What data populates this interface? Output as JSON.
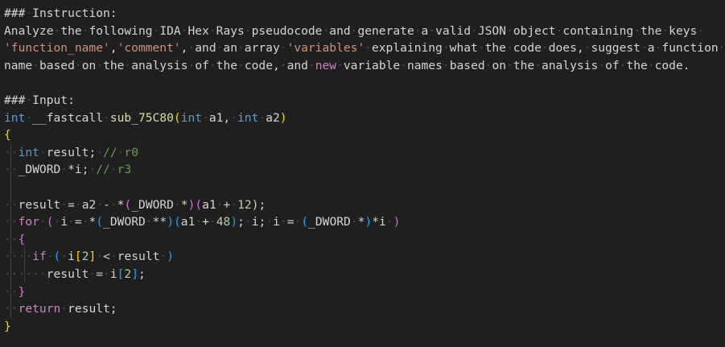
{
  "lines": [
    [
      {
        "t": "###",
        "c": "txt"
      },
      {
        "t": "·",
        "c": "ws"
      },
      {
        "t": "Instruction:",
        "c": "txt"
      }
    ],
    [
      {
        "t": "Analyze",
        "c": "txt"
      },
      {
        "t": "·",
        "c": "ws"
      },
      {
        "t": "the",
        "c": "txt"
      },
      {
        "t": "·",
        "c": "ws"
      },
      {
        "t": "following",
        "c": "txt"
      },
      {
        "t": "·",
        "c": "ws"
      },
      {
        "t": "IDA",
        "c": "txt"
      },
      {
        "t": "·",
        "c": "ws"
      },
      {
        "t": "Hex",
        "c": "txt"
      },
      {
        "t": "·",
        "c": "ws"
      },
      {
        "t": "Rays",
        "c": "txt"
      },
      {
        "t": "·",
        "c": "ws"
      },
      {
        "t": "pseudocode",
        "c": "txt"
      },
      {
        "t": "·",
        "c": "ws"
      },
      {
        "t": "and",
        "c": "txt"
      },
      {
        "t": "·",
        "c": "ws"
      },
      {
        "t": "generate",
        "c": "txt"
      },
      {
        "t": "·",
        "c": "ws"
      },
      {
        "t": "a",
        "c": "txt"
      },
      {
        "t": "·",
        "c": "ws"
      },
      {
        "t": "valid",
        "c": "txt"
      },
      {
        "t": "·",
        "c": "ws"
      },
      {
        "t": "JSON",
        "c": "txt"
      },
      {
        "t": "·",
        "c": "ws"
      },
      {
        "t": "object",
        "c": "txt"
      },
      {
        "t": "·",
        "c": "ws"
      },
      {
        "t": "containing",
        "c": "txt"
      },
      {
        "t": "·",
        "c": "ws"
      },
      {
        "t": "the",
        "c": "txt"
      },
      {
        "t": "·",
        "c": "ws"
      },
      {
        "t": "keys",
        "c": "txt"
      },
      {
        "t": "·",
        "c": "ws"
      }
    ],
    [
      {
        "t": "'function_name'",
        "c": "str"
      },
      {
        "t": ",",
        "c": "txt"
      },
      {
        "t": "'comment'",
        "c": "str"
      },
      {
        "t": ",",
        "c": "txt"
      },
      {
        "t": "·",
        "c": "ws"
      },
      {
        "t": "and",
        "c": "txt"
      },
      {
        "t": "·",
        "c": "ws"
      },
      {
        "t": "an",
        "c": "txt"
      },
      {
        "t": "·",
        "c": "ws"
      },
      {
        "t": "array",
        "c": "txt"
      },
      {
        "t": "·",
        "c": "ws"
      },
      {
        "t": "'variables'",
        "c": "str"
      },
      {
        "t": "·",
        "c": "ws"
      },
      {
        "t": "explaining",
        "c": "txt"
      },
      {
        "t": "·",
        "c": "ws"
      },
      {
        "t": "what",
        "c": "txt"
      },
      {
        "t": "·",
        "c": "ws"
      },
      {
        "t": "the",
        "c": "txt"
      },
      {
        "t": "·",
        "c": "ws"
      },
      {
        "t": "code",
        "c": "txt"
      },
      {
        "t": "·",
        "c": "ws"
      },
      {
        "t": "does,",
        "c": "txt"
      },
      {
        "t": "·",
        "c": "ws"
      },
      {
        "t": "suggest",
        "c": "txt"
      },
      {
        "t": "·",
        "c": "ws"
      },
      {
        "t": "a",
        "c": "txt"
      },
      {
        "t": "·",
        "c": "ws"
      },
      {
        "t": "function",
        "c": "txt"
      },
      {
        "t": "·",
        "c": "ws"
      }
    ],
    [
      {
        "t": "name",
        "c": "txt"
      },
      {
        "t": "·",
        "c": "ws"
      },
      {
        "t": "based",
        "c": "txt"
      },
      {
        "t": "·",
        "c": "ws"
      },
      {
        "t": "on",
        "c": "txt"
      },
      {
        "t": "·",
        "c": "ws"
      },
      {
        "t": "the",
        "c": "txt"
      },
      {
        "t": "·",
        "c": "ws"
      },
      {
        "t": "analysis",
        "c": "txt"
      },
      {
        "t": "·",
        "c": "ws"
      },
      {
        "t": "of",
        "c": "txt"
      },
      {
        "t": "·",
        "c": "ws"
      },
      {
        "t": "the",
        "c": "txt"
      },
      {
        "t": "·",
        "c": "ws"
      },
      {
        "t": "code,",
        "c": "txt"
      },
      {
        "t": "·",
        "c": "ws"
      },
      {
        "t": "and",
        "c": "txt"
      },
      {
        "t": "·",
        "c": "ws"
      },
      {
        "t": "new",
        "c": "ctl"
      },
      {
        "t": "·",
        "c": "ws"
      },
      {
        "t": "variable",
        "c": "txt"
      },
      {
        "t": "·",
        "c": "ws"
      },
      {
        "t": "names",
        "c": "txt"
      },
      {
        "t": "·",
        "c": "ws"
      },
      {
        "t": "based",
        "c": "txt"
      },
      {
        "t": "·",
        "c": "ws"
      },
      {
        "t": "on",
        "c": "txt"
      },
      {
        "t": "·",
        "c": "ws"
      },
      {
        "t": "the",
        "c": "txt"
      },
      {
        "t": "·",
        "c": "ws"
      },
      {
        "t": "analysis",
        "c": "txt"
      },
      {
        "t": "·",
        "c": "ws"
      },
      {
        "t": "of",
        "c": "txt"
      },
      {
        "t": "·",
        "c": "ws"
      },
      {
        "t": "the",
        "c": "txt"
      },
      {
        "t": "·",
        "c": "ws"
      },
      {
        "t": "code.",
        "c": "txt"
      }
    ],
    [],
    [
      {
        "t": "###",
        "c": "txt"
      },
      {
        "t": "·",
        "c": "ws"
      },
      {
        "t": "Input:",
        "c": "txt"
      }
    ],
    [
      {
        "t": "int",
        "c": "kw"
      },
      {
        "t": "·",
        "c": "ws"
      },
      {
        "t": "__fastcall",
        "c": "txt"
      },
      {
        "t": "·",
        "c": "ws"
      },
      {
        "t": "sub_75C80",
        "c": "fn"
      },
      {
        "t": "(",
        "c": "br1"
      },
      {
        "t": "int",
        "c": "kw"
      },
      {
        "t": "·",
        "c": "ws"
      },
      {
        "t": "a1,",
        "c": "txt"
      },
      {
        "t": "·",
        "c": "ws"
      },
      {
        "t": "int",
        "c": "kw"
      },
      {
        "t": "·",
        "c": "ws"
      },
      {
        "t": "a2",
        "c": "txt"
      },
      {
        "t": ")",
        "c": "br1"
      }
    ],
    [
      {
        "t": "{",
        "c": "br1"
      }
    ],
    [
      {
        "t": "··",
        "c": "ws"
      },
      {
        "t": "int",
        "c": "kw"
      },
      {
        "t": "·",
        "c": "ws"
      },
      {
        "t": "result;",
        "c": "txt"
      },
      {
        "t": "·",
        "c": "ws"
      },
      {
        "t": "//",
        "c": "cmt"
      },
      {
        "t": "·",
        "c": "ws"
      },
      {
        "t": "r0",
        "c": "cmt"
      }
    ],
    [
      {
        "t": "··",
        "c": "ws"
      },
      {
        "t": "_DWORD",
        "c": "txt"
      },
      {
        "t": "·",
        "c": "ws"
      },
      {
        "t": "*i;",
        "c": "txt"
      },
      {
        "t": "·",
        "c": "ws"
      },
      {
        "t": "//",
        "c": "cmt"
      },
      {
        "t": "·",
        "c": "ws"
      },
      {
        "t": "r3",
        "c": "cmt"
      }
    ],
    [],
    [
      {
        "t": "··",
        "c": "ws"
      },
      {
        "t": "result",
        "c": "txt"
      },
      {
        "t": "·",
        "c": "ws"
      },
      {
        "t": "=",
        "c": "txt"
      },
      {
        "t": "·",
        "c": "ws"
      },
      {
        "t": "a2",
        "c": "txt"
      },
      {
        "t": "·",
        "c": "ws"
      },
      {
        "t": "-",
        "c": "txt"
      },
      {
        "t": "·",
        "c": "ws"
      },
      {
        "t": "*",
        "c": "txt"
      },
      {
        "t": "(",
        "c": "br2"
      },
      {
        "t": "_DWORD",
        "c": "txt"
      },
      {
        "t": "·",
        "c": "ws"
      },
      {
        "t": "*",
        "c": "txt"
      },
      {
        "t": ")",
        "c": "br2"
      },
      {
        "t": "(",
        "c": "br2"
      },
      {
        "t": "a1",
        "c": "txt"
      },
      {
        "t": "·",
        "c": "ws"
      },
      {
        "t": "+",
        "c": "txt"
      },
      {
        "t": "·",
        "c": "ws"
      },
      {
        "t": "12",
        "c": "num"
      },
      {
        "t": ");",
        "c": "txt"
      }
    ],
    [
      {
        "t": "··",
        "c": "ws"
      },
      {
        "t": "for",
        "c": "ctl"
      },
      {
        "t": "·",
        "c": "ws"
      },
      {
        "t": "(",
        "c": "br2"
      },
      {
        "t": "·",
        "c": "ws"
      },
      {
        "t": "i",
        "c": "txt"
      },
      {
        "t": "·",
        "c": "ws"
      },
      {
        "t": "=",
        "c": "txt"
      },
      {
        "t": "·",
        "c": "ws"
      },
      {
        "t": "*",
        "c": "txt"
      },
      {
        "t": "(",
        "c": "br3"
      },
      {
        "t": "_DWORD",
        "c": "txt"
      },
      {
        "t": "·",
        "c": "ws"
      },
      {
        "t": "**",
        "c": "txt"
      },
      {
        "t": ")",
        "c": "br3"
      },
      {
        "t": "(",
        "c": "br3"
      },
      {
        "t": "a1",
        "c": "txt"
      },
      {
        "t": "·",
        "c": "ws"
      },
      {
        "t": "+",
        "c": "txt"
      },
      {
        "t": "·",
        "c": "ws"
      },
      {
        "t": "48",
        "c": "num"
      },
      {
        "t": ")",
        "c": "br3"
      },
      {
        "t": ";",
        "c": "txt"
      },
      {
        "t": "·",
        "c": "ws"
      },
      {
        "t": "i;",
        "c": "txt"
      },
      {
        "t": "·",
        "c": "ws"
      },
      {
        "t": "i",
        "c": "txt"
      },
      {
        "t": "·",
        "c": "ws"
      },
      {
        "t": "=",
        "c": "txt"
      },
      {
        "t": "·",
        "c": "ws"
      },
      {
        "t": "(",
        "c": "br3"
      },
      {
        "t": "_DWORD",
        "c": "txt"
      },
      {
        "t": "·",
        "c": "ws"
      },
      {
        "t": "*",
        "c": "txt"
      },
      {
        "t": ")",
        "c": "br3"
      },
      {
        "t": "*i",
        "c": "txt"
      },
      {
        "t": "·",
        "c": "ws"
      },
      {
        "t": ")",
        "c": "br2"
      }
    ],
    [
      {
        "t": "··",
        "c": "ws"
      },
      {
        "t": "{",
        "c": "br2"
      }
    ],
    [
      {
        "t": "····",
        "c": "ws"
      },
      {
        "t": "if",
        "c": "ctl"
      },
      {
        "t": "·",
        "c": "ws"
      },
      {
        "t": "(",
        "c": "br3"
      },
      {
        "t": "·",
        "c": "ws"
      },
      {
        "t": "i",
        "c": "txt"
      },
      {
        "t": "[",
        "c": "br1"
      },
      {
        "t": "2",
        "c": "num"
      },
      {
        "t": "]",
        "c": "br1"
      },
      {
        "t": "·",
        "c": "ws"
      },
      {
        "t": "<",
        "c": "txt"
      },
      {
        "t": "·",
        "c": "ws"
      },
      {
        "t": "result",
        "c": "txt"
      },
      {
        "t": "·",
        "c": "ws"
      },
      {
        "t": ")",
        "c": "br3"
      }
    ],
    [
      {
        "t": "······",
        "c": "ws"
      },
      {
        "t": "result",
        "c": "txt"
      },
      {
        "t": "·",
        "c": "ws"
      },
      {
        "t": "=",
        "c": "txt"
      },
      {
        "t": "·",
        "c": "ws"
      },
      {
        "t": "i",
        "c": "txt"
      },
      {
        "t": "[",
        "c": "br3"
      },
      {
        "t": "2",
        "c": "num"
      },
      {
        "t": "]",
        "c": "br3"
      },
      {
        "t": ";",
        "c": "txt"
      }
    ],
    [
      {
        "t": "··",
        "c": "ws"
      },
      {
        "t": "}",
        "c": "br2"
      }
    ],
    [
      {
        "t": "··",
        "c": "ws"
      },
      {
        "t": "return",
        "c": "ctl"
      },
      {
        "t": "·",
        "c": "ws"
      },
      {
        "t": "result;",
        "c": "txt"
      }
    ],
    [
      {
        "t": "}",
        "c": "br1"
      }
    ]
  ],
  "colors": {
    "background": "#1f1f1f",
    "text": "#d4d4d4",
    "keyword": "#569cd6",
    "control": "#c586c0",
    "string": "#ce9178",
    "number": "#b5cea8",
    "comment": "#6a9955",
    "function": "#dcdcaa",
    "bracket1": "#ffd700",
    "bracket2": "#da70d6",
    "bracket3": "#179fff",
    "whitespace_marker": "#4b4b4b"
  }
}
